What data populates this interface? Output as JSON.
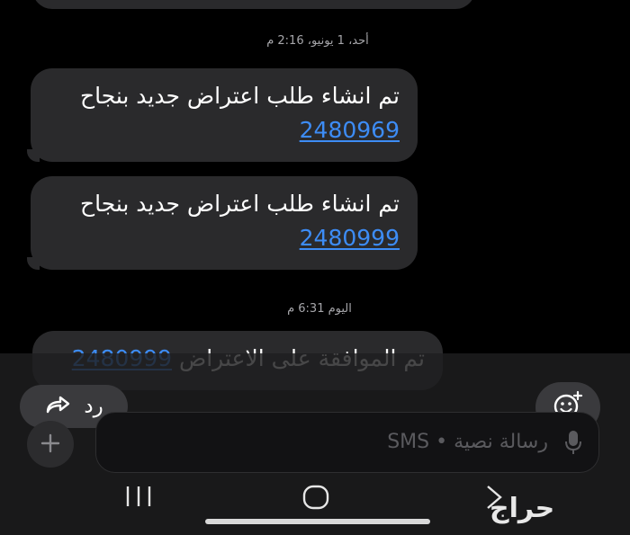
{
  "thread": {
    "timestamp_1": "أحد، 1 يونيو، 2:16 م",
    "timestamp_2": "اليوم 6:31 م",
    "messages": [
      {
        "text": "تم انشاء طلب اعتراض جديد بنجاح",
        "number": "2480969"
      },
      {
        "text": "تم انشاء طلب اعتراض جديد بنجاح",
        "number": "2480999"
      },
      {
        "text": "تم الموافقة على الاعتراض",
        "number": "2480999"
      }
    ]
  },
  "actions": {
    "reply_label": "رد",
    "reply_icon": "forward-arrow-icon",
    "emoji_icon": "emoji-plus-icon",
    "add_icon": "plus-icon"
  },
  "composer": {
    "placeholder": "رسالة نصية • SMS",
    "mic_icon": "mic-icon"
  },
  "watermark": "حراج"
}
